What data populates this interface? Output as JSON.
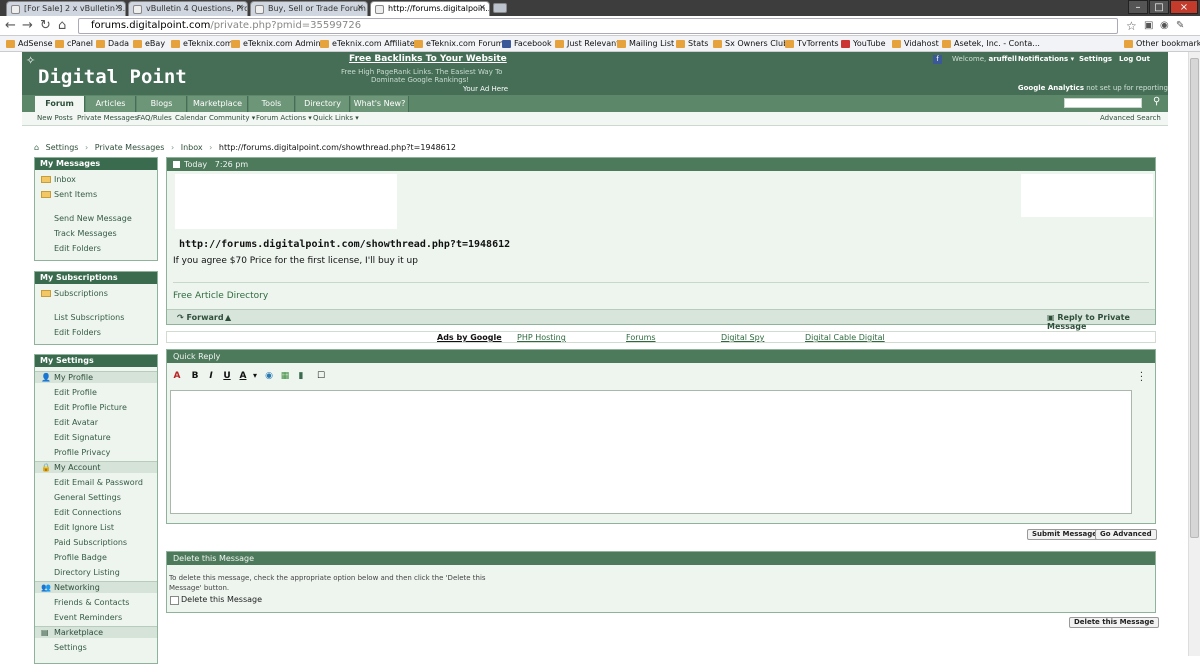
{
  "browser": {
    "tabs": [
      {
        "label": "[For Sale] 2 x vBulletin 3.x..."
      },
      {
        "label": "vBulletin 4 Questions, Pro..."
      },
      {
        "label": "Buy, Sell or Trade Forum"
      },
      {
        "label": "http://forums.digitalpoin..."
      }
    ],
    "url_host": "forums.digitalpoint.com",
    "url_path": "/private.php?pmid=35599726",
    "bookmarks": [
      "AdSense",
      "cPanel",
      "Dada",
      "eBay",
      "eTeknix.com",
      "eTeknix.com Admin",
      "eTeknix.com Affiliates",
      "eTeknix.com Forums",
      "Facebook",
      "Just Relevant",
      "Mailing List",
      "Stats",
      "Sx Owners Club",
      "TvTorrents",
      "YouTube",
      "Vidahost",
      "Asetek, Inc. - Conta..."
    ],
    "other_bookmarks": "Other bookmarks"
  },
  "header": {
    "logo": "Digital Point",
    "ad_headline": "Free Backlinks To Your Website",
    "ad_line1": "Free High PageRank Links. The Easiest Way To",
    "ad_line2": "Dominate Google Rankings!",
    "ad_here": "Your Ad Here",
    "welcome_prefix": "Welcome,",
    "username": "aruffell",
    "notifications": "Notifications ▾",
    "settings": "Settings",
    "logout": "Log Out",
    "ga_label": "Google Analytics",
    "ga_status": "not set up for reporting"
  },
  "nav": {
    "tabs": [
      "Forum",
      "Articles",
      "Blogs",
      "Marketplace",
      "Tools",
      "Directory",
      "What's New?"
    ],
    "subnav": [
      "New Posts",
      "Private Messages",
      "FAQ/Rules",
      "Calendar",
      "Community ▾",
      "Forum Actions ▾",
      "Quick Links ▾"
    ],
    "advanced_search": "Advanced Search"
  },
  "breadcrumb": [
    "Settings",
    "Private Messages",
    "Inbox",
    "http://forums.digitalpoint.com/showthread.php?t=1948612"
  ],
  "sidebar": {
    "my_messages": {
      "title": "My Messages",
      "items": [
        "Inbox",
        "Sent Items",
        "Send New Message",
        "Track Messages",
        "Edit Folders"
      ]
    },
    "my_subscriptions": {
      "title": "My Subscriptions",
      "items": [
        "Subscriptions",
        "List Subscriptions",
        "Edit Folders"
      ]
    },
    "my_settings": {
      "title": "My Settings",
      "groups": {
        "profile": "My Profile",
        "account": "My Account",
        "networking": "Networking",
        "marketplace": "Marketplace"
      },
      "profile_items": [
        "Edit Profile",
        "Edit Profile Picture",
        "Edit Avatar",
        "Edit Signature",
        "Profile Privacy"
      ],
      "account_items": [
        "Edit Email & Password",
        "General Settings",
        "Edit Connections",
        "Edit Ignore List",
        "Paid Subscriptions",
        "Profile Badge",
        "Directory Listing"
      ],
      "networking_items": [
        "Friends & Contacts",
        "Event Reminders"
      ],
      "marketplace_items": [
        "Settings"
      ]
    }
  },
  "message": {
    "date": "Today",
    "time": "7:26 pm",
    "title": "http://forums.digitalpoint.com/showthread.php?t=1948612",
    "text": "If you agree $70 Price for the first license, I'll buy it up",
    "signature": "Free Article Directory",
    "forward": "Forward",
    "reply": "Reply to Private Message"
  },
  "ads": {
    "label": "Ads by Google",
    "links": [
      "PHP Hosting",
      "Forums",
      "Digital Spy",
      "Digital Cable Digital"
    ]
  },
  "quick_reply": {
    "title": "Quick Reply",
    "submit": "Submit Message",
    "advanced": "Go Advanced"
  },
  "delete": {
    "title": "Delete this Message",
    "instructions": "To delete this message, check the appropriate option below and then click the 'Delete this Message' button.",
    "checkbox_label": "Delete this Message",
    "button": "Delete this Message"
  }
}
